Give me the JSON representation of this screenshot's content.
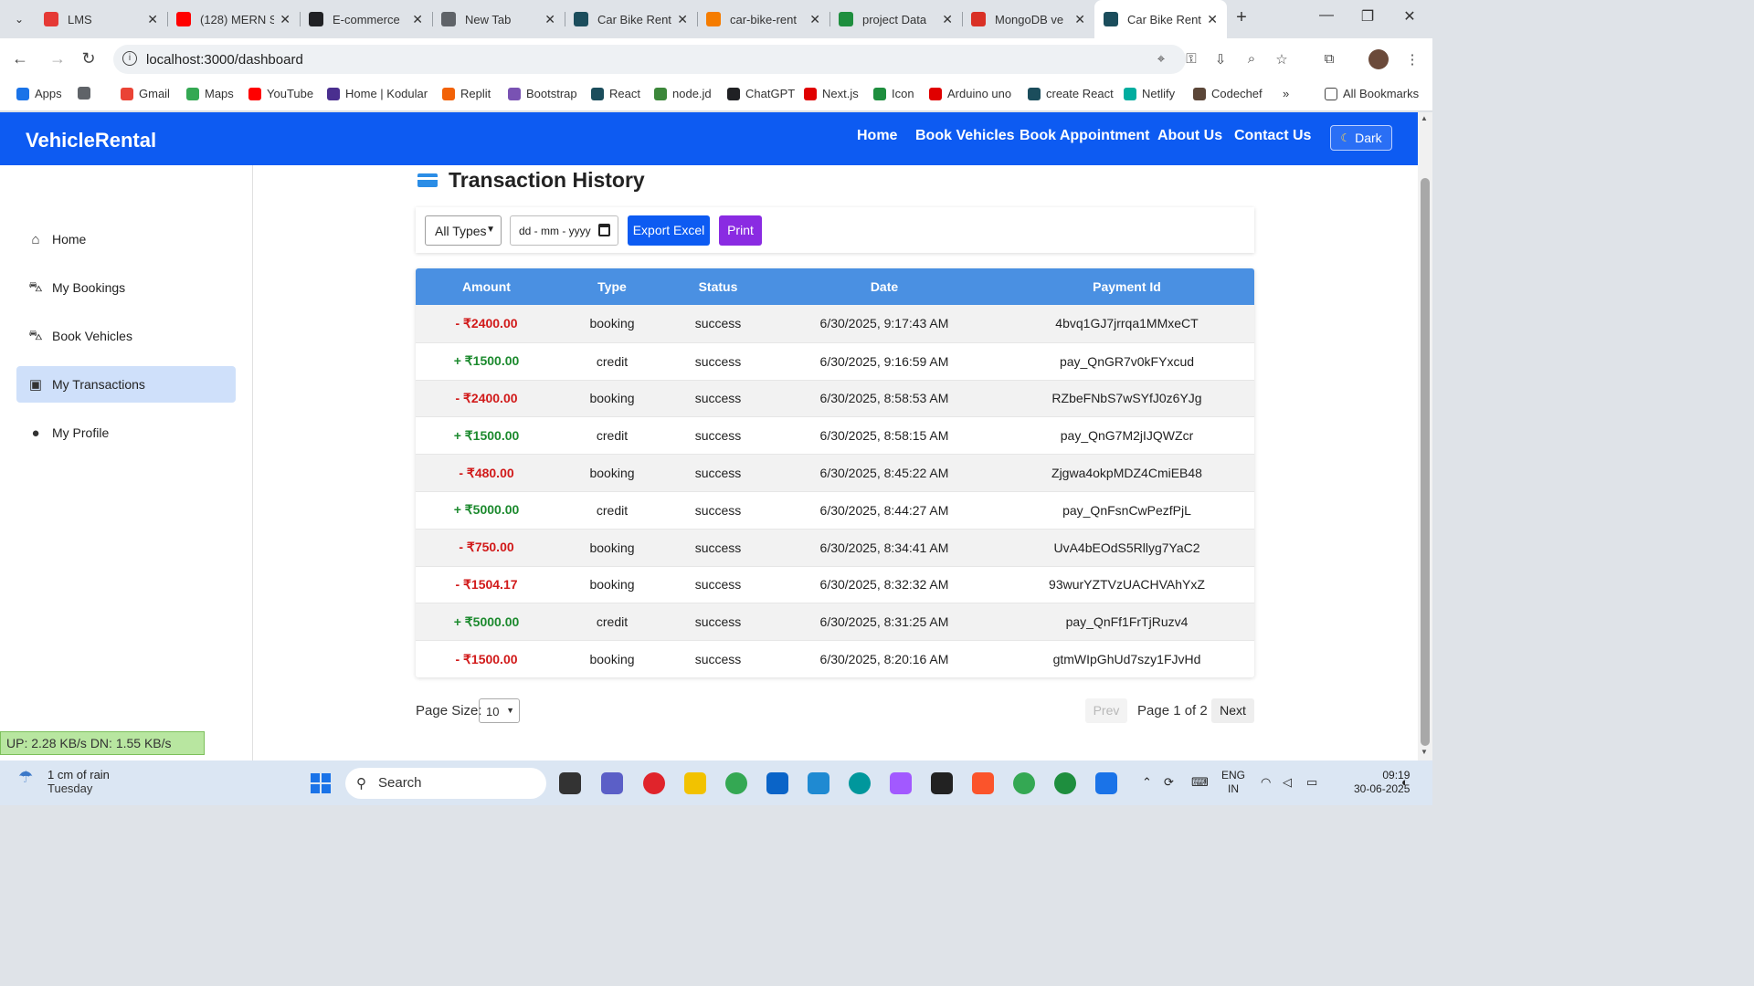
{
  "browser": {
    "tabs": [
      {
        "title": "LMS",
        "color": "#e53935",
        "active": false
      },
      {
        "title": "(128) MERN S",
        "color": "#ff0000",
        "active": false
      },
      {
        "title": "E-commerce",
        "color": "#202124",
        "active": false
      },
      {
        "title": "New Tab",
        "color": "#5f6368",
        "active": false
      },
      {
        "title": "Car Bike Rent",
        "color": "#1b4d5c",
        "active": false
      },
      {
        "title": "car-bike-rent",
        "color": "#f57c00",
        "active": false
      },
      {
        "title": "project Data",
        "color": "#1e8e3e",
        "active": false
      },
      {
        "title": "MongoDB ve",
        "color": "#d93025",
        "active": false
      },
      {
        "title": "Car Bike Rent",
        "color": "#1b4d5c",
        "active": true
      }
    ],
    "url": "localhost:3000/dashboard",
    "bookmarks": [
      {
        "label": "Apps",
        "color": "#1a73e8"
      },
      {
        "label": "",
        "color": "#5f6368"
      },
      {
        "label": "Gmail",
        "color": "#ea4335"
      },
      {
        "label": "Maps",
        "color": "#34a853"
      },
      {
        "label": "YouTube",
        "color": "#ff0000"
      },
      {
        "label": "Home | Kodular",
        "color": "#4a2f8f"
      },
      {
        "label": "Replit",
        "color": "#f26207"
      },
      {
        "label": "Bootstrap",
        "color": "#7952b3"
      },
      {
        "label": "React",
        "color": "#1b4d5c"
      },
      {
        "label": "node.jd",
        "color": "#3c873a"
      },
      {
        "label": "ChatGPT",
        "color": "#202124"
      },
      {
        "label": "Next.js",
        "color": "#e00000"
      },
      {
        "label": "Icon",
        "color": "#1e8e3e"
      },
      {
        "label": "Arduino uno",
        "color": "#e00000"
      },
      {
        "label": "create React",
        "color": "#1b4d5c"
      },
      {
        "label": "Netlify",
        "color": "#00ad9f"
      },
      {
        "label": "Codechef",
        "color": "#5b4638"
      }
    ],
    "bookmarks_more": "»",
    "all_bookmarks": "All Bookmarks"
  },
  "app": {
    "brand": "VehicleRental",
    "nav": [
      "Home",
      "Book Vehicles",
      "Book Appointment",
      "About Us",
      "Contact Us"
    ],
    "theme_button": "Dark",
    "accent": "#0d5bf2"
  },
  "sidebar": {
    "items": [
      {
        "label": "Home",
        "icon": "home-icon",
        "active": false
      },
      {
        "label": "My Bookings",
        "icon": "car-icon",
        "active": false
      },
      {
        "label": "Book Vehicles",
        "icon": "car-icon",
        "active": false
      },
      {
        "label": "My Transactions",
        "icon": "wallet-icon",
        "active": true
      },
      {
        "label": "My Profile",
        "icon": "user-icon",
        "active": false
      }
    ]
  },
  "page": {
    "title": "Transaction History",
    "filter_type": "All Types",
    "date_placeholder": "dd - mm - yyyy",
    "export_label": "Export Excel",
    "print_label": "Print"
  },
  "table": {
    "headers": [
      "Amount",
      "Type",
      "Status",
      "Date",
      "Payment Id"
    ],
    "rows": [
      {
        "amount": "- ₹2400.00",
        "type": "booking",
        "status": "success",
        "date": "6/30/2025, 9:17:43 AM",
        "payment_id": "4bvq1GJ7jrrqa1MMxeCT"
      },
      {
        "amount": "+ ₹1500.00",
        "type": "credit",
        "status": "success",
        "date": "6/30/2025, 9:16:59 AM",
        "payment_id": "pay_QnGR7v0kFYxcud"
      },
      {
        "amount": "- ₹2400.00",
        "type": "booking",
        "status": "success",
        "date": "6/30/2025, 8:58:53 AM",
        "payment_id": "RZbeFNbS7wSYfJ0z6YJg"
      },
      {
        "amount": "+ ₹1500.00",
        "type": "credit",
        "status": "success",
        "date": "6/30/2025, 8:58:15 AM",
        "payment_id": "pay_QnG7M2jIJQWZcr"
      },
      {
        "amount": "- ₹480.00",
        "type": "booking",
        "status": "success",
        "date": "6/30/2025, 8:45:22 AM",
        "payment_id": "Zjgwa4okpMDZ4CmiEB48"
      },
      {
        "amount": "+ ₹5000.00",
        "type": "credit",
        "status": "success",
        "date": "6/30/2025, 8:44:27 AM",
        "payment_id": "pay_QnFsnCwPezfPjL"
      },
      {
        "amount": "- ₹750.00",
        "type": "booking",
        "status": "success",
        "date": "6/30/2025, 8:34:41 AM",
        "payment_id": "UvA4bEOdS5Rllyg7YaC2"
      },
      {
        "amount": "- ₹1504.17",
        "type": "booking",
        "status": "success",
        "date": "6/30/2025, 8:32:32 AM",
        "payment_id": "93wurYZTVzUACHVAhYxZ"
      },
      {
        "amount": "+ ₹5000.00",
        "type": "credit",
        "status": "success",
        "date": "6/30/2025, 8:31:25 AM",
        "payment_id": "pay_QnFf1FrTjRuzv4"
      },
      {
        "amount": "- ₹1500.00",
        "type": "booking",
        "status": "success",
        "date": "6/30/2025, 8:20:16 AM",
        "payment_id": "gtmWIpGhUd7szy1FJvHd"
      }
    ]
  },
  "pager": {
    "label": "Page Size:",
    "size": "10",
    "prev": "Prev",
    "info": "Page 1 of 2",
    "next": "Next"
  },
  "netmon": "UP: 2.28 KB/s     DN: 1.55 KB/s",
  "taskbar": {
    "weather_title": "1 cm of rain",
    "weather_sub": "Tuesday",
    "search": "Search",
    "lang_1": "ENG",
    "lang_2": "IN",
    "time": "09:19",
    "date": "30-06-2025"
  }
}
